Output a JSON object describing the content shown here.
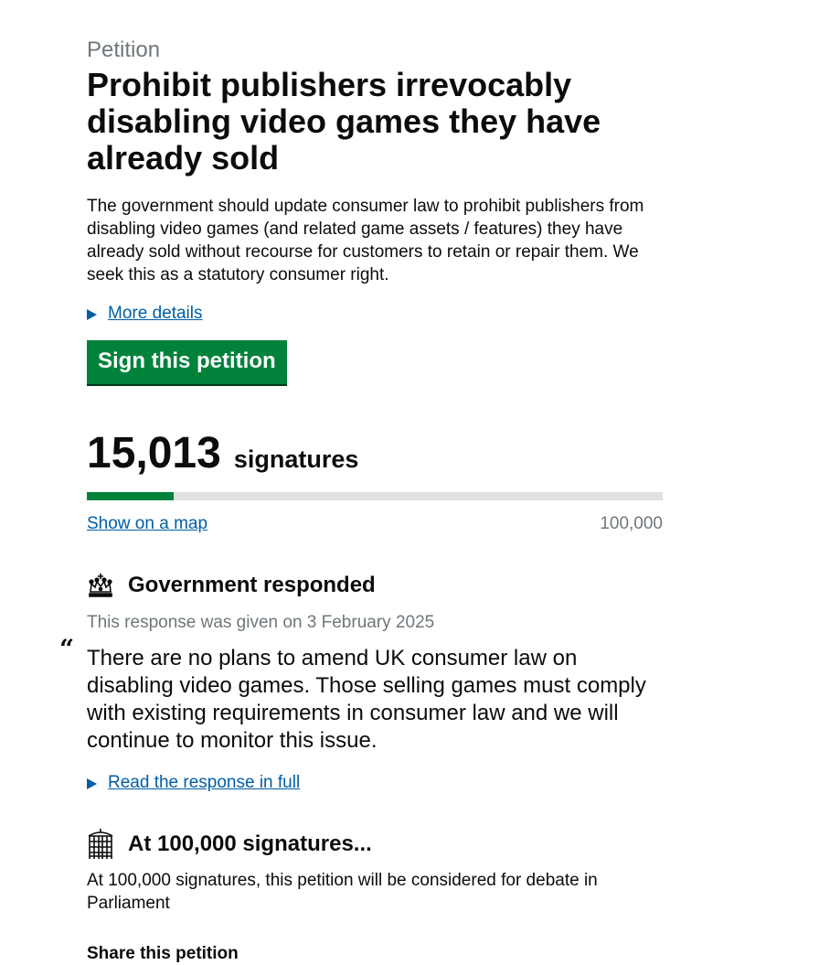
{
  "petition": {
    "caption": "Petition",
    "title": "Prohibit publishers irrevocably disabling video games they have already sold",
    "summary": "The government should update consumer law to prohibit publishers from disabling video games (and related game assets / features) they have already sold without recourse for customers to retain or repair them. We seek this as a statutory consumer right.",
    "more_details_label": "More details",
    "sign_button_label": "Sign this petition"
  },
  "signatures": {
    "count": "15,013",
    "label": "signatures",
    "progress_fraction": 0.15013,
    "show_map_label": "Show on a map",
    "threshold_label": "100,000"
  },
  "response": {
    "heading": "Government responded",
    "date_text": "This response was given on 3 February 2025",
    "quote_mark": "“",
    "quote": "There are no plans to amend UK consumer law on disabling video games. Those selling games must comply with existing requirements in consumer law and we will continue to monitor this issue.",
    "read_full_label": "Read the response in full"
  },
  "debate": {
    "heading": "At 100,000 signatures...",
    "text": "At 100,000 signatures, this petition will be considered for debate in Parliament"
  },
  "share": {
    "heading": "Share this petition"
  },
  "colors": {
    "link": "#005ea5",
    "button": "#00823b",
    "progress_fill": "#00823b",
    "progress_track": "#dee0e2",
    "secondary_text": "#6f777b"
  },
  "icons": {
    "crown": "crown-icon",
    "parliament": "portcullis-icon",
    "disclosure": "triangle-right-icon"
  }
}
